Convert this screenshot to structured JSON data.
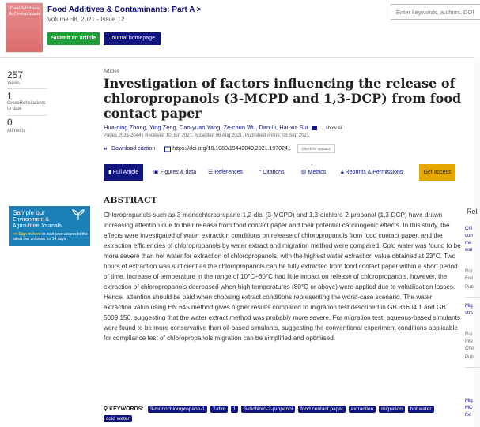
{
  "journal": {
    "cover_title": "Food Additives & Contaminants",
    "title": "Food Additives & Contaminants: Part A",
    "chevron": ">",
    "volume": "Volume 38, 2021 - Issue 12",
    "submit_label": "Submit an article",
    "homepage_label": "Journal homepage"
  },
  "search": {
    "placeholder": "Enter keywords, authors, DOI"
  },
  "metrics": [
    {
      "value": "257",
      "label": "Views"
    },
    {
      "value": "1",
      "label": "CrossRef citations to date"
    },
    {
      "value": "0",
      "label": "Altmetric"
    }
  ],
  "article": {
    "kicker": "Articles",
    "title": "Investigation of factors influencing the release of chloropropanols (3-MCPD and 1,3-DCP) from food contact paper",
    "authors": "Hua-ning Zhong, Ying Zeng, Dao-yuan Yang, Ze-chun Wu, Dan Li, Hai-xia Sui",
    "show_all": "...show all",
    "dates": "Pages 2036-2044  |  Received 10 Jun 2021, Accepted 06 Aug 2021, Published online: 03 Sep 2021",
    "download": "Download citation",
    "doi": "https://doi.org/10.1080/19440049.2021.1970241",
    "crossmark": "Check for updates"
  },
  "tabs": {
    "full": "Full Article",
    "figures": "Figures & data",
    "references": "References",
    "citations": "Citations",
    "metrics": "Metrics",
    "reprints": "Reprints & Permissions",
    "access": "Get access"
  },
  "abstract": {
    "heading": "ABSTRACT",
    "text": "Chloropropanols such as 3-monochloropropane-1,2-diol (3-MCPD) and 1,3-dichloro-2-propanol (1,3-DCP) have drawn increasing attention due to their release from food contact paper and their potential carcinogenic effects. In this study, the effects were investigated of water extraction conditions on release of chloropropanols from food contact paper, and the extraction efficiencies of chloropropanols by water extract and migration method were compared. Cold water was found to be more severe than hot water for extraction of chloropropanols, with the highest water extraction value obtained at 23°C. Two hours of extraction was sufficient as the chloropropanols can be fully extracted from food contact paper within a short period of time. Increase of temperature in the range of 10°C–60°C had little impact on release of chloropropanols, however, the extraction of chloropropanols decreased when high temperatures (80°C or above) were applied due to volatilisation losses. Hence, attention should be paid when choosing extract conditions representing the worst-case scenario. The water extraction value using EN 645 method gives higher results compared to migration test described in GB 31604.1 and GB 5009.156, suggesting that the water extract method was probably more severe. For migration test, aqueous-based simulants were found to be more conservative than oil-based simulants, suggesting the conventional experiment conditions applicable for compliance test of chloropropanols migration can be simplified and optimised."
  },
  "keywords": {
    "label": "KEYWORDS:",
    "items": [
      "3-monochloropropane-1",
      "2-diol",
      "1",
      "3-dichloro-2-propanol",
      "food contact paper",
      "extraction",
      "migration",
      "hot water",
      "cold water"
    ]
  },
  "ad": {
    "line1": "Sample our",
    "line2": "Environment & Agriculture Journals",
    "line3_link": ">> Sign in here",
    "line3_rest": " to start your access to the latest two volumes for 14 days"
  },
  "related": {
    "heading": "Rel",
    "items": [
      {
        "text": "Chl",
        "grey": false
      },
      {
        "text": "con",
        "grey": false
      },
      {
        "text": "ma",
        "grey": false
      },
      {
        "text": "wal",
        "grey": false
      },
      {
        "text": "Rol",
        "grey": true
      },
      {
        "text": "Foo",
        "grey": true
      },
      {
        "text": "Pub",
        "grey": true
      },
      {
        "text": "Mig",
        "grey": false
      },
      {
        "text": "stra",
        "grey": false
      },
      {
        "text": "Rui",
        "grey": true
      },
      {
        "text": "Inte",
        "grey": true
      },
      {
        "text": "Che",
        "grey": true
      },
      {
        "text": "Pub",
        "grey": true
      },
      {
        "text": "Mig",
        "grey": false
      },
      {
        "text": "MC",
        "grey": false
      },
      {
        "text": "foo",
        "grey": false
      }
    ]
  },
  "colors": {
    "brand": "#10147e",
    "submit": "#1f9e3a",
    "access": "#e6a800"
  }
}
